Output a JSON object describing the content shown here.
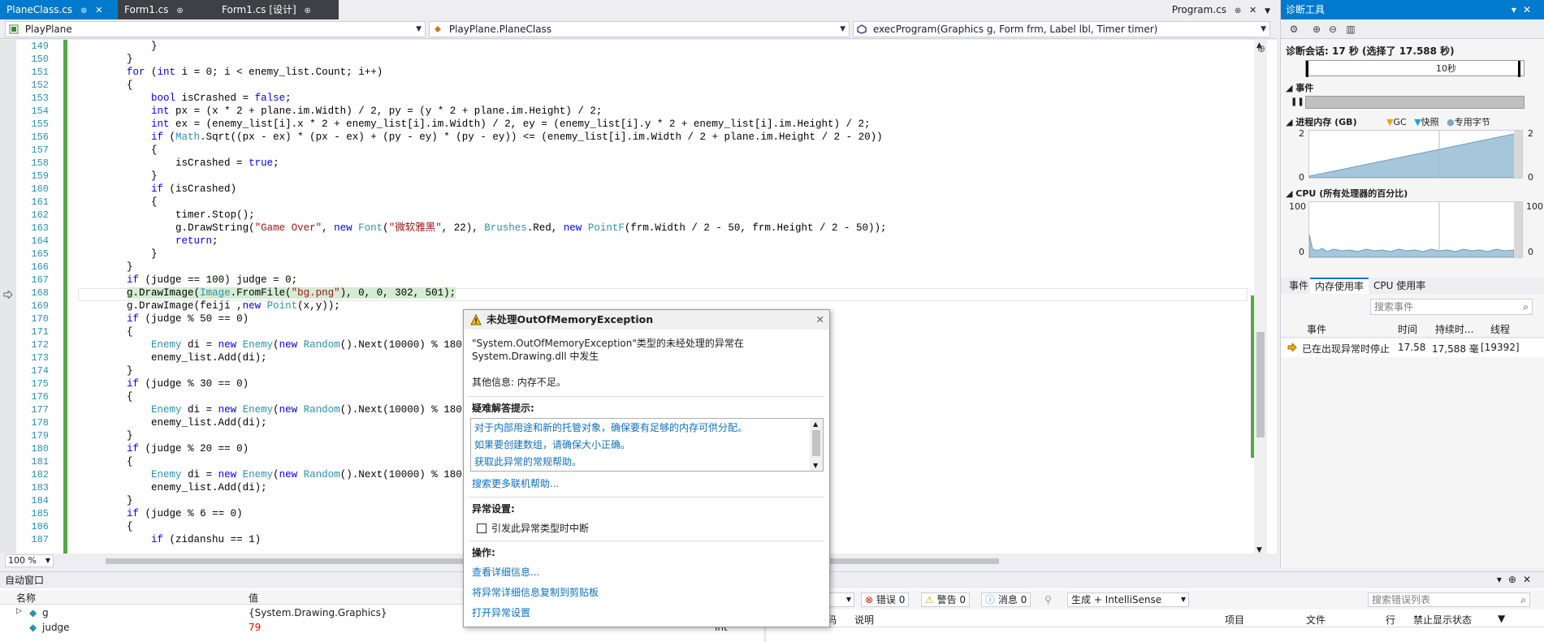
{
  "tabs": [
    {
      "label": "PlaneClass.cs",
      "pin": "⊕",
      "close": "✕"
    },
    {
      "label": "Form1.cs",
      "pin": "⊕"
    },
    {
      "label": "Form1.cs [设计]",
      "pin": "⊕"
    }
  ],
  "tabs_right": {
    "label": "Program.cs",
    "pin": "⊕",
    "close": "✕"
  },
  "nav": {
    "project": "PlayPlane",
    "class": "PlayPlane.PlaneClass",
    "method": "execProgram(Graphics g, Form frm, Label lbl, Timer timer)"
  },
  "editor": {
    "lines": [
      {
        "n": "149",
        "t": "            }"
      },
      {
        "n": "150",
        "t": "        }"
      },
      {
        "n": "151",
        "t": "        for (int i = 0; i < enemy_list.Count; i++)"
      },
      {
        "n": "152",
        "t": "        {"
      },
      {
        "n": "153",
        "t": "            bool isCrashed = false;"
      },
      {
        "n": "154",
        "t": "            int px = (x * 2 + plane.im.Width) / 2, py = (y * 2 + plane.im.Height) / 2;"
      },
      {
        "n": "155",
        "t": "            int ex = (enemy_list[i].x * 2 + enemy_list[i].im.Width) / 2, ey = (enemy_list[i].y * 2 + enemy_list[i].im.Height) / 2;"
      },
      {
        "n": "156",
        "t": "            if (Math.Sqrt((px - ex) * (px - ex) + (py - ey) * (py - ey)) <= (enemy_list[i].im.Width / 2 + plane.im.Height / 2 - 20))"
      },
      {
        "n": "157",
        "t": "            {"
      },
      {
        "n": "158",
        "t": "                isCrashed = true;"
      },
      {
        "n": "159",
        "t": "            }"
      },
      {
        "n": "160",
        "t": "            if (isCrashed)"
      },
      {
        "n": "161",
        "t": "            {"
      },
      {
        "n": "162",
        "t": "                timer.Stop();"
      },
      {
        "n": "163",
        "t": "                g.DrawString(\"Game Over\", new Font(\"微软雅黑\", 22), Brushes.Red, new PointF(frm.Width / 2 - 50, frm.Height / 2 - 50));"
      },
      {
        "n": "164",
        "t": "                return;"
      },
      {
        "n": "165",
        "t": "            }"
      },
      {
        "n": "166",
        "t": "        }"
      },
      {
        "n": "167",
        "t": "        if (judge == 100) judge = 0;"
      },
      {
        "n": "168",
        "t": "        g.DrawImage(Image.FromFile(\"bg.png\"), 0, 0, 302, 501);"
      },
      {
        "n": "169",
        "t": "        g.DrawImage(feiji ,new Point(x,y));"
      },
      {
        "n": "170",
        "t": "        if (judge % 50 == 0)"
      },
      {
        "n": "171",
        "t": "        {"
      },
      {
        "n": "172",
        "t": "            Enemy di = new Enemy(new Random().Next(10000) % 180,"
      },
      {
        "n": "173",
        "t": "            enemy_list.Add(di);"
      },
      {
        "n": "174",
        "t": "        }"
      },
      {
        "n": "175",
        "t": "        if (judge % 30 == 0)"
      },
      {
        "n": "176",
        "t": "        {"
      },
      {
        "n": "177",
        "t": "            Enemy di = new Enemy(new Random().Next(10000) % 180,"
      },
      {
        "n": "178",
        "t": "            enemy_list.Add(di);"
      },
      {
        "n": "179",
        "t": "        }"
      },
      {
        "n": "180",
        "t": "        if (judge % 20 == 0)"
      },
      {
        "n": "181",
        "t": "        {"
      },
      {
        "n": "182",
        "t": "            Enemy di = new Enemy(new Random().Next(10000) % 180,"
      },
      {
        "n": "183",
        "t": "            enemy_list.Add(di);"
      },
      {
        "n": "184",
        "t": "        }"
      },
      {
        "n": "185",
        "t": "        if (judge % 6 == 0)"
      },
      {
        "n": "186",
        "t": "        {"
      },
      {
        "n": "187",
        "t": "            if (zidanshu == 1)"
      }
    ],
    "zoom": "100 %"
  },
  "exception": {
    "title": "未处理OutOfMemoryException",
    "message_line1": "\"System.OutOfMemoryException\"类型的未经处理的异常在",
    "message_line2": "System.Drawing.dll 中发生",
    "extra_info": "其他信息: 内存不足。",
    "hints_title": "疑难解答提示:",
    "hints": [
      "对于内部用途和新的托管对象，确保要有足够的内存可供分配。",
      "如果要创建数组，请确保大小正确。",
      "获取此异常的常规帮助。"
    ],
    "more_help": "搜索更多联机帮助...",
    "settings_title": "异常设置:",
    "break_checkbox": "引发此异常类型时中断",
    "actions_title": "操作:",
    "actions": [
      "查看详细信息...",
      "将异常详细信息复制到剪贴板",
      "打开异常设置"
    ]
  },
  "diagnostics": {
    "title": "诊断工具",
    "session": "诊断会话: 17 秒 (选择了 17.588 秒)",
    "timeline_label": "10秒",
    "events_label": "事件",
    "memory_label": "进程内存 (GB)",
    "memory_legend": [
      "GC",
      "快照",
      "专用字节"
    ],
    "memory_max": "2",
    "memory_min": "0",
    "cpu_label": "CPU (所有处理器的百分比)",
    "cpu_max": "100",
    "cpu_min": "0",
    "tabs": [
      "事件",
      "内存使用率",
      "CPU 使用率"
    ],
    "search_placeholder": "搜索事件",
    "columns": [
      "事件",
      "时间",
      "持续时...",
      "线程"
    ],
    "event_row": {
      "event": "已在出现异常时停止",
      "time": "17.58",
      "duration": "17,588 毫",
      "thread": "[19392]"
    }
  },
  "autos": {
    "title": "自动窗口",
    "columns": [
      "名称",
      "值"
    ],
    "rows": [
      {
        "name": "g",
        "value": "{System.Drawing.Graphics}",
        "type": ""
      },
      {
        "name": "judge",
        "value": "79",
        "type": "int"
      }
    ]
  },
  "errors": {
    "scope_suffix": "案",
    "errors": "错误 0",
    "warnings": "警告 0",
    "messages": "消息 0",
    "build": "生成 + IntelliSense",
    "search_placeholder": "搜索错误列表",
    "columns": [
      "码",
      "说明",
      "项目",
      "文件",
      "行",
      "禁止显示状态"
    ]
  },
  "colors": {
    "accent": "#007ACC",
    "keyword": "#0000FF",
    "type": "#2B91AF",
    "string": "#A31515",
    "link": "#0E70C0"
  }
}
